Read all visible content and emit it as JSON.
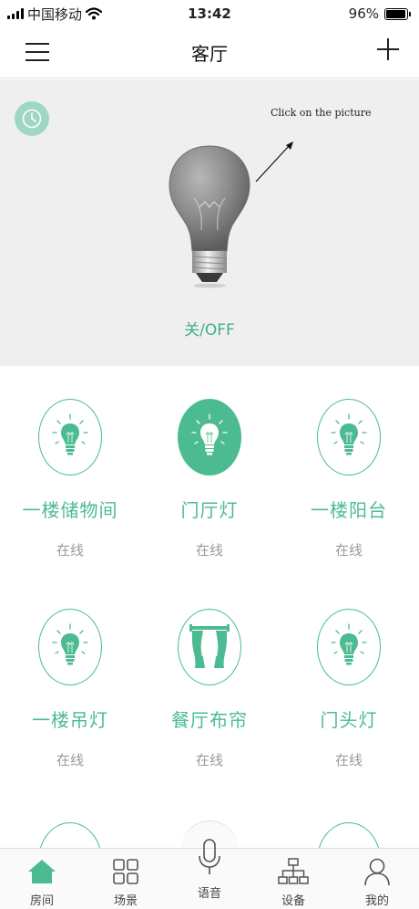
{
  "status_bar": {
    "carrier": "中国移动",
    "time": "13:42",
    "battery": "96%",
    "battery_level": 0.96,
    "icons": [
      "signal-icon",
      "wifi-icon",
      "battery-icon"
    ]
  },
  "header": {
    "title": "客厅",
    "left_icon": "menu-icon",
    "right_icon": "plus-icon"
  },
  "hero": {
    "hint": "Click on the picture",
    "state": "关/OFF",
    "icons": [
      "timer-icon",
      "bulb-icon",
      "arrow-icon"
    ]
  },
  "devices": [
    {
      "name": "一楼储物间",
      "status": "在线",
      "icon": "bulb-icon",
      "active": false
    },
    {
      "name": "门厅灯",
      "status": "在线",
      "icon": "bulb-icon",
      "active": true
    },
    {
      "name": "一楼阳台",
      "status": "在线",
      "icon": "bulb-icon",
      "active": false
    },
    {
      "name": "一楼吊灯",
      "status": "在线",
      "icon": "bulb-icon",
      "active": false
    },
    {
      "name": "餐厅布帘",
      "status": "在线",
      "icon": "curtain-icon",
      "active": false
    },
    {
      "name": "门头灯",
      "status": "在线",
      "icon": "bulb-icon",
      "active": false
    }
  ],
  "tabs": [
    {
      "label": "房间",
      "icon": "home-icon",
      "active": true
    },
    {
      "label": "场景",
      "icon": "grid-icon",
      "active": false
    },
    {
      "label": "语音",
      "icon": "microphone-icon",
      "active": false
    },
    {
      "label": "设备",
      "icon": "network-icon",
      "active": false
    },
    {
      "label": "我的",
      "icon": "user-icon",
      "active": false
    }
  ],
  "colors": {
    "accent": "#4cbb92",
    "hero_bg": "#efefef",
    "timer_bg": "#9fd8c2",
    "status_gray": "#9a9a9a"
  }
}
